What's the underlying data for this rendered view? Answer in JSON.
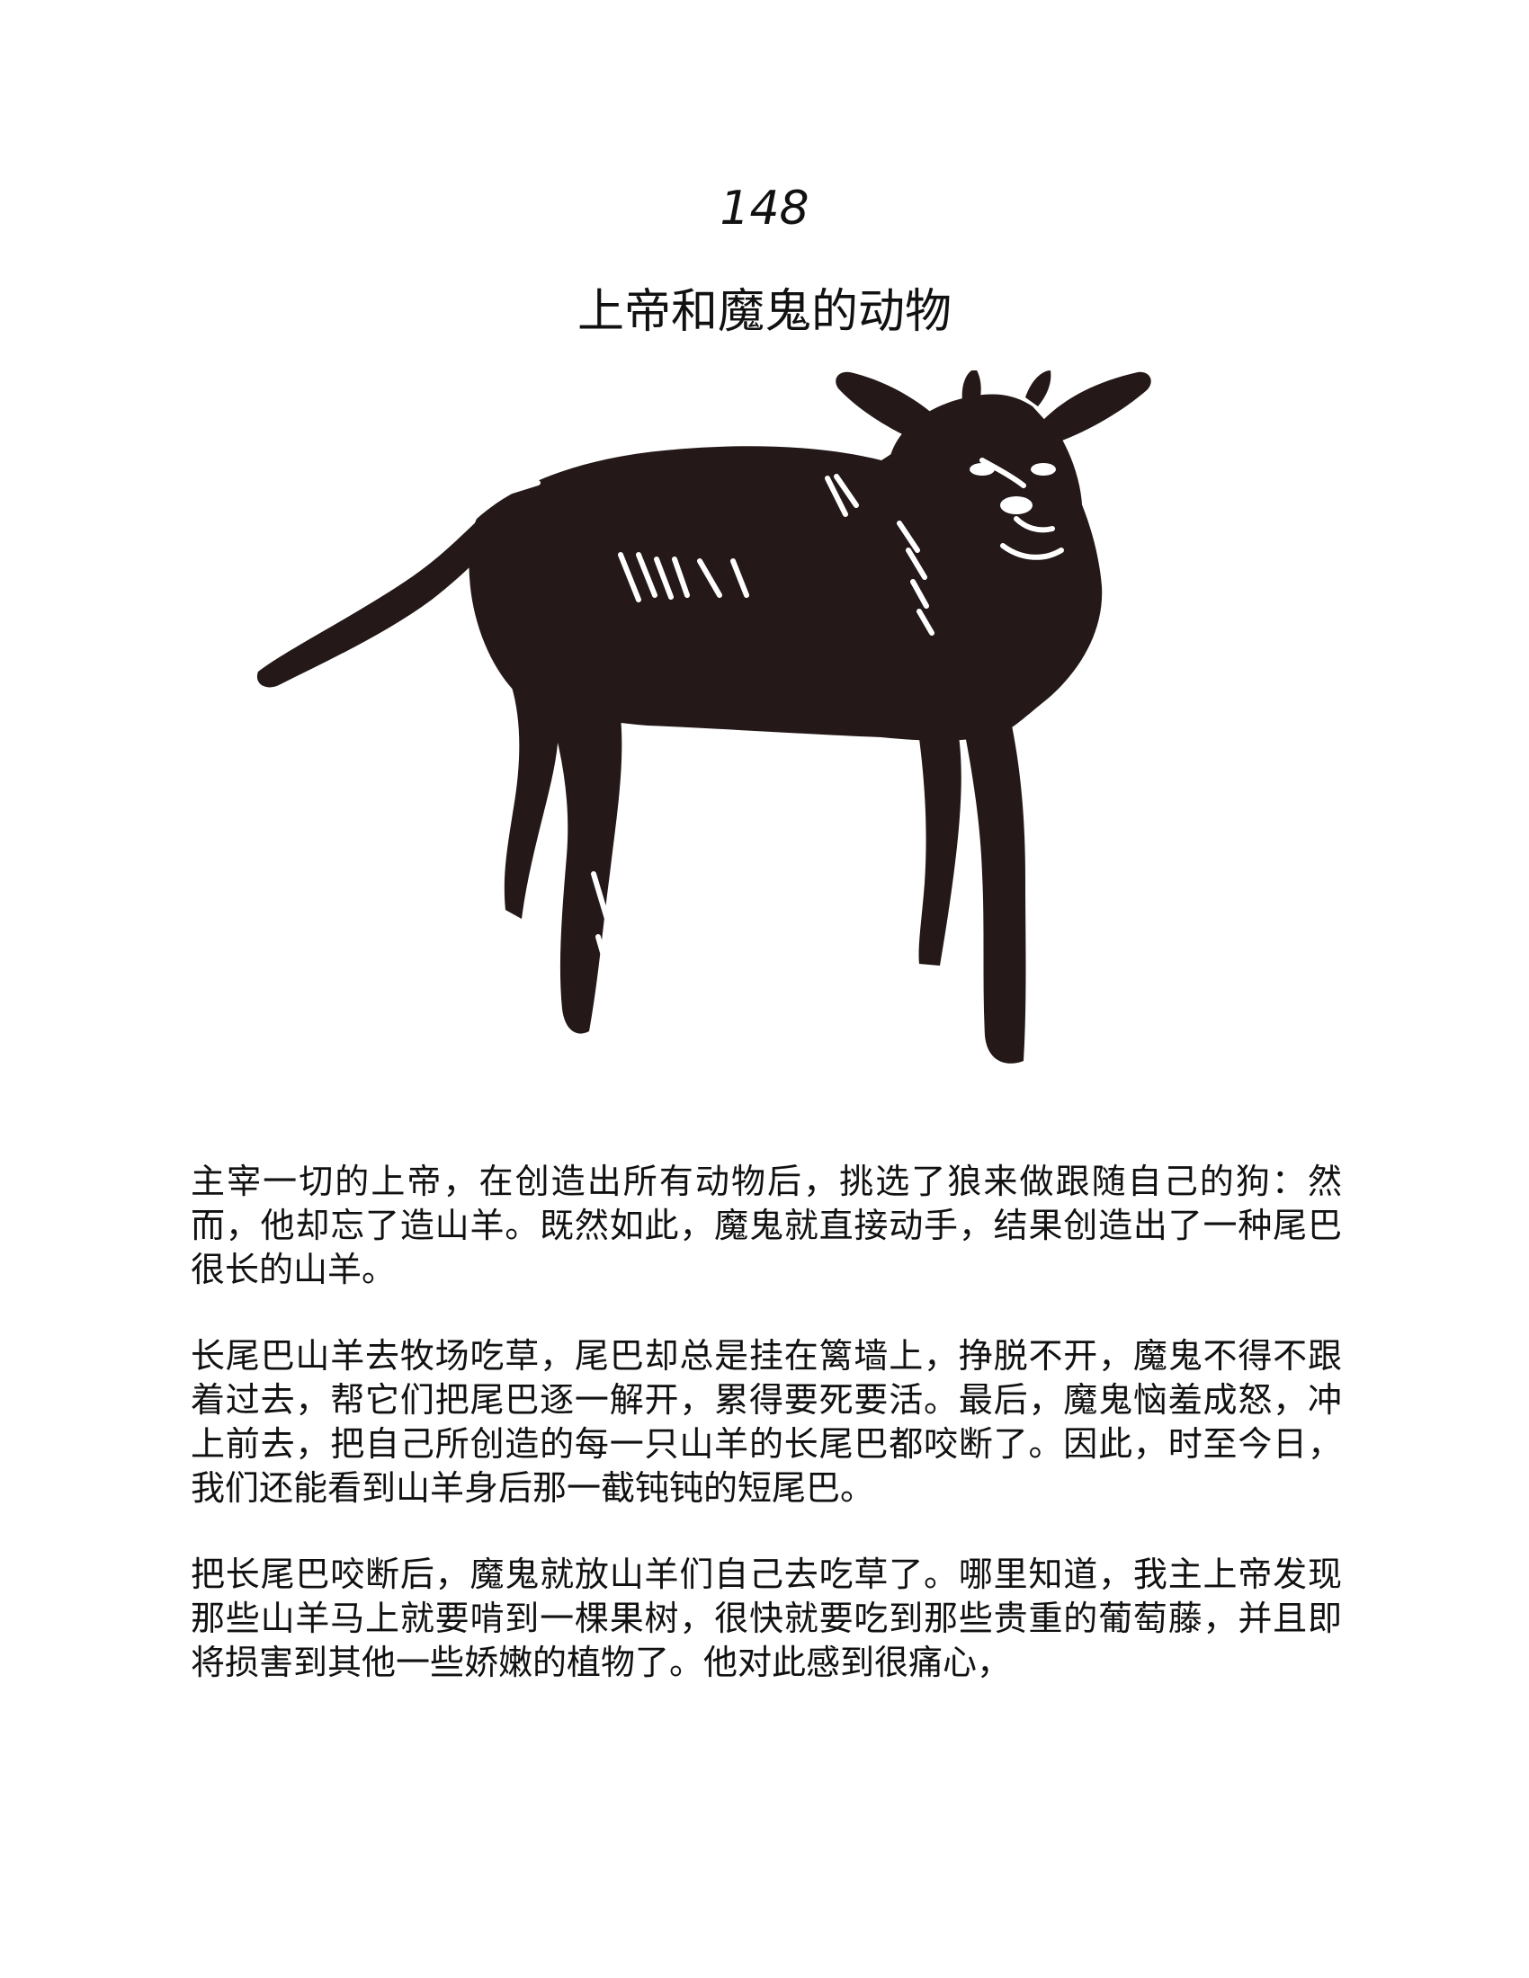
{
  "page": {
    "chapter_number": "148",
    "chapter_title": "上帝和魔鬼的动物",
    "illustration_icon": "goat-illustration",
    "paragraphs": [
      "主宰一切的上帝，在创造出所有动物后，挑选了狼来做跟随自己的狗：然而，他却忘了造山羊。既然如此，魔鬼就直接动手，结果创造出了一种尾巴很长的山羊。",
      "长尾巴山羊去牧场吃草，尾巴却总是挂在篱墙上，挣脱不开，魔鬼不得不跟着过去，帮它们把尾巴逐一解开，累得要死要活。最后，魔鬼恼羞成怒，冲上前去，把自己所创造的每一只山羊的长尾巴都咬断了。因此，时至今日，我们还能看到山羊身后那一截钝钝的短尾巴。",
      "把长尾巴咬断后，魔鬼就放山羊们自己去吃草了。哪里知道，我主上帝发现那些山羊马上就要啃到一棵果树，很快就要吃到那些贵重的葡萄藤，并且即将损害到其他一些娇嫩的植物了。他对此感到很痛心，"
    ]
  }
}
